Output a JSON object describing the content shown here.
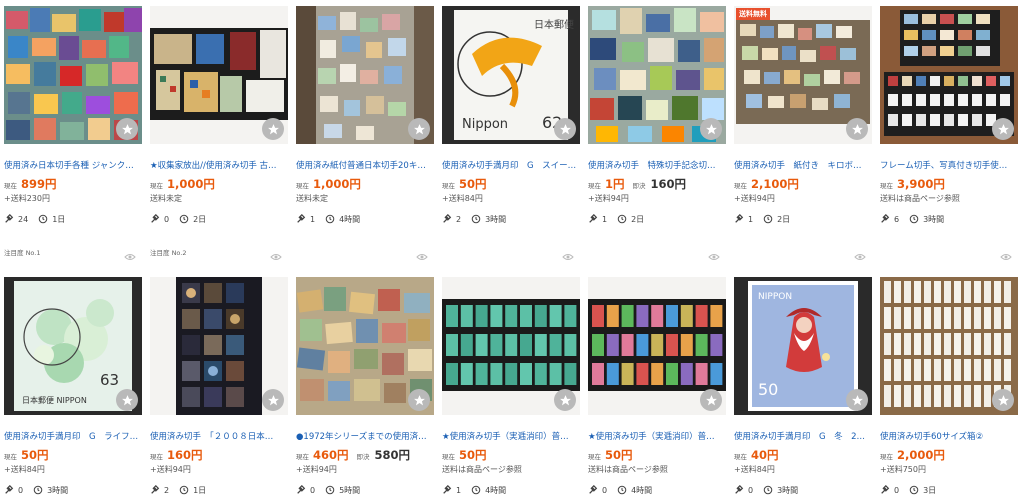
{
  "colors": {
    "link": "#1a5fb4",
    "price": "#e85a0c",
    "badge": "#e8502d",
    "favorite": "#b9b9b9"
  },
  "rows": [
    {
      "items": [
        {
          "title": "使用済み日本切手各種 ジャンク…",
          "price_label": "現在",
          "price": "899円",
          "ship": "+送料230円",
          "bids": "24",
          "time": "1日",
          "img": "stamps-mix-1"
        },
        {
          "title": "★収集家放出//使用済み切手 古…",
          "price_label": "現在",
          "price": "1,000円",
          "ship": "送料未定",
          "bids": "0",
          "time": "2日",
          "img": "collection-album"
        },
        {
          "title": "使用済み紙付普通日本切手20キ…",
          "price_label": "現在",
          "price": "1,000円",
          "ship": "送料未定",
          "bids": "1",
          "time": "4時間",
          "img": "stamps-paper-box"
        },
        {
          "title": "使用済み切手満月印　G　スイー…",
          "price_label": "現在",
          "price": "50円",
          "ship": "+送料84円",
          "bids": "2",
          "time": "3時間",
          "img": "stamp-nippon-62"
        },
        {
          "title": "使用済み切手　特殊切手記念切…",
          "price_label": "現在",
          "price": "1円",
          "bid_label": "即決",
          "bid_price": "160円",
          "ship": "+送料94円",
          "bids": "1",
          "time": "2日",
          "img": "stamps-mix-2"
        },
        {
          "title": "使用済み切手　紙付き　キロボ…",
          "price_label": "現在",
          "price": "2,100円",
          "ship": "+送料94円",
          "bids": "1",
          "time": "2日",
          "img": "stamps-tray",
          "badge": "送料無料"
        },
        {
          "title": "フレーム切手、写真付き切手使…",
          "price_label": "現在",
          "price": "3,900円",
          "ship": "送料は商品ページ参照",
          "bids": "6",
          "time": "3時間",
          "img": "frame-stamps"
        }
      ],
      "ranks": [
        "注目度 No.1",
        "注目度 No.2"
      ]
    },
    {
      "items": [
        {
          "title": "使用済み切手満月印　G　ライフ…",
          "price_label": "現在",
          "price": "50円",
          "ship": "+送料84円",
          "bids": "0",
          "time": "3時間",
          "img": "stamp-flowers-63"
        },
        {
          "title": "使用済み切手　「２００８日本…",
          "price_label": "現在",
          "price": "160円",
          "ship": "+送料94円",
          "bids": "2",
          "time": "1日",
          "img": "space-sheet"
        },
        {
          "title": "●1972年シリーズまでの使用済…",
          "price_label": "現在",
          "price": "460円",
          "bid_label": "即決",
          "bid_price": "580円",
          "ship": "+送料94円",
          "bids": "0",
          "time": "5時間",
          "img": "stamps-mix-3"
        },
        {
          "title": "★使用済み切手（実逓消印）普…",
          "price_label": "現在",
          "price": "50円",
          "ship": "送料は商品ページ参照",
          "bids": "1",
          "time": "4時間",
          "img": "grid-green"
        },
        {
          "title": "★使用済み切手（実逓消印）普…",
          "price_label": "現在",
          "price": "50円",
          "ship": "送料は商品ページ参照",
          "bids": "0",
          "time": "4時間",
          "img": "grid-mixed"
        },
        {
          "title": "使用済み切手満月印　G　冬　2…",
          "price_label": "現在",
          "price": "40円",
          "ship": "+送料84円",
          "bids": "0",
          "time": "3時間",
          "img": "stamp-santa-50"
        },
        {
          "title": "使用済み切手60サイズ箱②",
          "price_label": "現在",
          "price": "2,000円",
          "ship": "+送料750円",
          "bids": "0",
          "time": "3日",
          "img": "stamp-box-files"
        }
      ],
      "ranks": []
    }
  ],
  "stamp_text": {
    "nippon_62_value": "62",
    "nippon_62_word": "Nippon",
    "nippon_62_kanji": "日本郵便",
    "flowers_value": "63",
    "flowers_word": "日本郵便 NIPPON",
    "santa_word": "NIPPON",
    "santa_value": "50"
  }
}
